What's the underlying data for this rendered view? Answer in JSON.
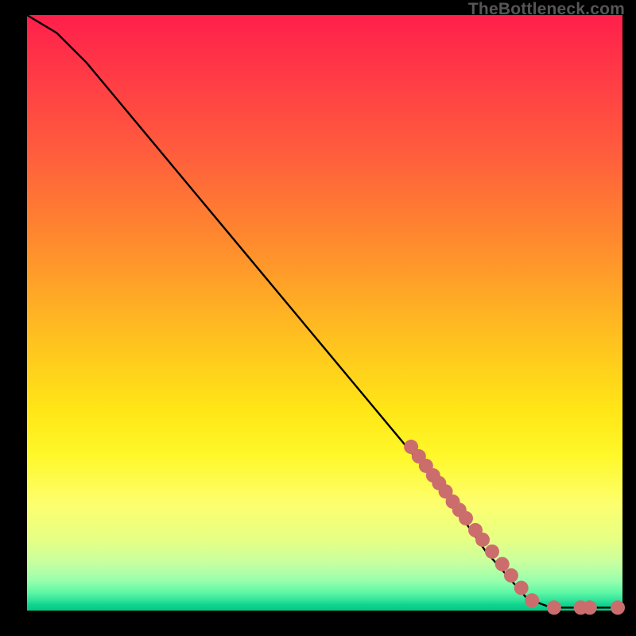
{
  "attribution": "TheBottleneck.com",
  "chart_data": {
    "type": "line",
    "title": "",
    "xlabel": "",
    "ylabel": "",
    "xlim": [
      0,
      100
    ],
    "ylim": [
      0,
      100
    ],
    "curve": [
      {
        "x": 0,
        "y": 100
      },
      {
        "x": 5,
        "y": 97
      },
      {
        "x": 10,
        "y": 92
      },
      {
        "x": 20,
        "y": 80
      },
      {
        "x": 30,
        "y": 68
      },
      {
        "x": 40,
        "y": 56
      },
      {
        "x": 50,
        "y": 44
      },
      {
        "x": 60,
        "y": 32
      },
      {
        "x": 70,
        "y": 20
      },
      {
        "x": 77,
        "y": 10
      },
      {
        "x": 84,
        "y": 2
      },
      {
        "x": 88,
        "y": 0.5
      },
      {
        "x": 100,
        "y": 0.5
      }
    ],
    "points": [
      {
        "x": 64.5,
        "y": 27.5
      },
      {
        "x": 65.8,
        "y": 25.9
      },
      {
        "x": 67.0,
        "y": 24.3
      },
      {
        "x": 68.2,
        "y": 22.7
      },
      {
        "x": 69.2,
        "y": 21.4
      },
      {
        "x": 70.3,
        "y": 20.0
      },
      {
        "x": 71.5,
        "y": 18.3
      },
      {
        "x": 72.6,
        "y": 16.9
      },
      {
        "x": 73.7,
        "y": 15.5
      },
      {
        "x": 75.3,
        "y": 13.5
      },
      {
        "x": 76.5,
        "y": 11.9
      },
      {
        "x": 78.1,
        "y": 9.9
      },
      {
        "x": 79.8,
        "y": 7.8
      },
      {
        "x": 81.3,
        "y": 5.9
      },
      {
        "x": 83.0,
        "y": 3.8
      },
      {
        "x": 84.8,
        "y": 1.7
      },
      {
        "x": 88.5,
        "y": 0.5
      },
      {
        "x": 93.0,
        "y": 0.5
      },
      {
        "x": 94.5,
        "y": 0.5
      },
      {
        "x": 99.2,
        "y": 0.5
      }
    ],
    "point_color": "#cc6d6d",
    "line_color": "#000000"
  }
}
